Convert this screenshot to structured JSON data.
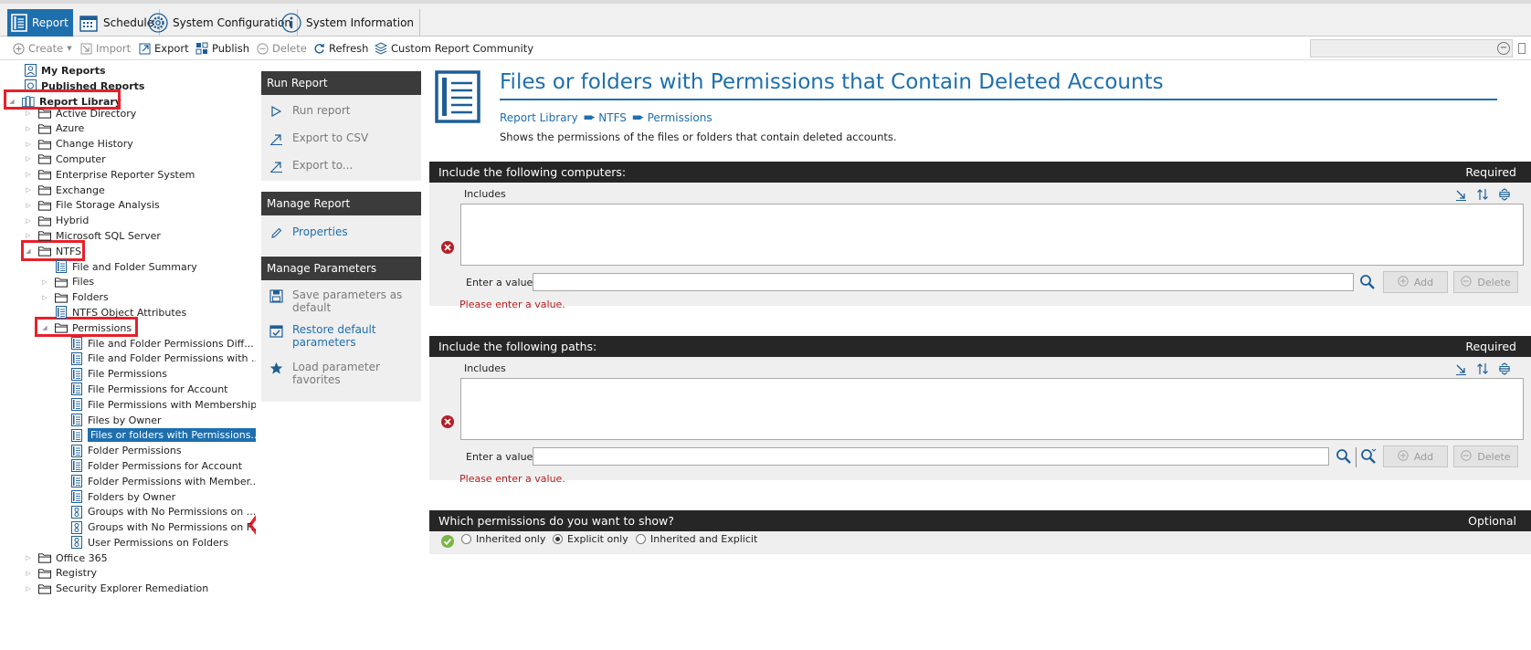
{
  "tabs": [
    {
      "label": "Report",
      "icon": "report-icon",
      "active": true
    },
    {
      "label": "Schedule",
      "icon": "calendar-icon",
      "active": false
    },
    {
      "label": "System Configuration",
      "icon": "gear-icon",
      "active": false
    },
    {
      "label": "System Information",
      "icon": "info-icon",
      "active": false
    }
  ],
  "toolbar": {
    "create": "Create",
    "import": "Import",
    "export": "Export",
    "publish": "Publish",
    "delete": "Delete",
    "refresh": "Refresh",
    "community": "Custom Report Community"
  },
  "tree": {
    "my_reports": "My Reports",
    "published_reports": "Published Reports",
    "report_library": "Report Library",
    "categories_top": [
      "Active Directory",
      "Azure",
      "Change History",
      "Computer",
      "Enterprise Reporter System",
      "Exchange",
      "File Storage Analysis",
      "Hybrid",
      "Microsoft SQL Server"
    ],
    "ntfs": "NTFS",
    "ntfs_children": [
      "File and Folder Summary",
      "Files",
      "Folders",
      "NTFS Object Attributes"
    ],
    "permissions": "Permissions",
    "permission_reports": [
      "File and Folder Permissions Diff...",
      "File and Folder Permissions with ...",
      "File Permissions",
      "File Permissions for Account",
      "File Permissions with Membership",
      "Files by Owner",
      "Files or folders with Permissions...",
      "Folder Permissions",
      "Folder Permissions for Account",
      "Folder Permissions with Member...",
      "Folders by Owner",
      "Groups with No Permissions on ...",
      "Groups with No Permissions on F...",
      "User Permissions on Folders"
    ],
    "categories_bottom": [
      "Office 365",
      "Registry",
      "Security Explorer Remediation"
    ]
  },
  "actions": {
    "run_report": {
      "title": "Run Report",
      "items": [
        "Run report",
        "Export to CSV",
        "Export to..."
      ]
    },
    "manage_report": {
      "title": "Manage Report",
      "items": [
        "Properties"
      ]
    },
    "manage_parameters": {
      "title": "Manage Parameters",
      "save": "Save parameters as default",
      "restore": "Restore default parameters",
      "load": "Load parameter favorites"
    }
  },
  "main": {
    "title": "Files or folders with Permissions that Contain Deleted Accounts",
    "breadcrumb": [
      "Report Library",
      "NTFS",
      "Permissions"
    ],
    "description": "Shows the permissions of the files or folders that contain deleted accounts.",
    "computers": {
      "heading": "Include the following computers:",
      "status": "Required",
      "includes": "Includes",
      "enter_label": "Enter a value:",
      "add": "Add",
      "delete": "Delete",
      "error": "Please enter a value."
    },
    "paths": {
      "heading": "Include the following paths:",
      "status": "Required",
      "includes": "Includes",
      "enter_label": "Enter a value:",
      "add": "Add",
      "delete": "Delete",
      "error": "Please enter a value."
    },
    "permissions": {
      "heading": "Which permissions do you want to show?",
      "status": "Optional",
      "options": [
        "Inherited only",
        "Explicit only",
        "Inherited and Explicit"
      ],
      "selected": "Explicit only"
    }
  },
  "colors": {
    "accent": "#1e6fae",
    "dark_header": "#262626",
    "highlight_box": "#e8202a",
    "error": "#b42222"
  }
}
